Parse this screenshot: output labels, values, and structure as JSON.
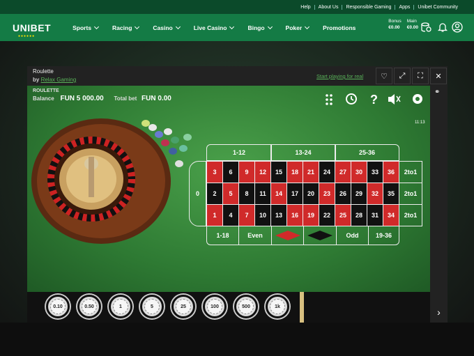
{
  "topbar": {
    "links": [
      "Help",
      "About Us",
      "Responsible Gaming",
      "Apps",
      "Unibet Community"
    ]
  },
  "nav": {
    "logo": "UNIBET",
    "items": [
      "Sports",
      "Racing",
      "Casino",
      "Live Casino",
      "Bingo",
      "Poker",
      "Promotions"
    ],
    "bonus_label": "Bonus",
    "bonus_value": "€0.00",
    "main_label": "Main",
    "main_value": "€0.00"
  },
  "game": {
    "title": "Roulette",
    "by": "by",
    "provider": "Relax Gaming",
    "play_real": "Start playing for real",
    "roulette_label": "ROULETTE",
    "balance_label": "Balance",
    "balance_value": "FUN 5 000.00",
    "totalbet_label": "Total bet",
    "totalbet_value": "FUN 0.00",
    "clock": "11:13",
    "dozens": [
      "1-12",
      "13-24",
      "25-36"
    ],
    "zero": "0",
    "rows": [
      [
        {
          "n": "3",
          "c": "red"
        },
        {
          "n": "6",
          "c": "blk"
        },
        {
          "n": "9",
          "c": "red"
        },
        {
          "n": "12",
          "c": "red"
        },
        {
          "n": "15",
          "c": "blk"
        },
        {
          "n": "18",
          "c": "red"
        },
        {
          "n": "21",
          "c": "red"
        },
        {
          "n": "24",
          "c": "blk"
        },
        {
          "n": "27",
          "c": "red"
        },
        {
          "n": "30",
          "c": "red"
        },
        {
          "n": "33",
          "c": "blk"
        },
        {
          "n": "36",
          "c": "red"
        }
      ],
      [
        {
          "n": "2",
          "c": "blk"
        },
        {
          "n": "5",
          "c": "red"
        },
        {
          "n": "8",
          "c": "blk"
        },
        {
          "n": "11",
          "c": "blk"
        },
        {
          "n": "14",
          "c": "red"
        },
        {
          "n": "17",
          "c": "blk"
        },
        {
          "n": "20",
          "c": "blk"
        },
        {
          "n": "23",
          "c": "red"
        },
        {
          "n": "26",
          "c": "blk"
        },
        {
          "n": "29",
          "c": "blk"
        },
        {
          "n": "32",
          "c": "red"
        },
        {
          "n": "35",
          "c": "blk"
        }
      ],
      [
        {
          "n": "1",
          "c": "red"
        },
        {
          "n": "4",
          "c": "blk"
        },
        {
          "n": "7",
          "c": "red"
        },
        {
          "n": "10",
          "c": "blk"
        },
        {
          "n": "13",
          "c": "blk"
        },
        {
          "n": "16",
          "c": "red"
        },
        {
          "n": "19",
          "c": "red"
        },
        {
          "n": "22",
          "c": "blk"
        },
        {
          "n": "25",
          "c": "red"
        },
        {
          "n": "28",
          "c": "blk"
        },
        {
          "n": "31",
          "c": "blk"
        },
        {
          "n": "34",
          "c": "red"
        }
      ]
    ],
    "columns": [
      "2to1",
      "2to1",
      "2to1"
    ],
    "outside": [
      "1-18",
      "Even",
      "",
      "",
      "Odd",
      "19-36"
    ],
    "chips": [
      "0.10",
      "0.50",
      "1",
      "5",
      "25",
      "100",
      "500",
      "1k"
    ]
  },
  "colors": {
    "brand": "#147b45",
    "red": "#d02a2a",
    "felt": "#2e7a33"
  }
}
